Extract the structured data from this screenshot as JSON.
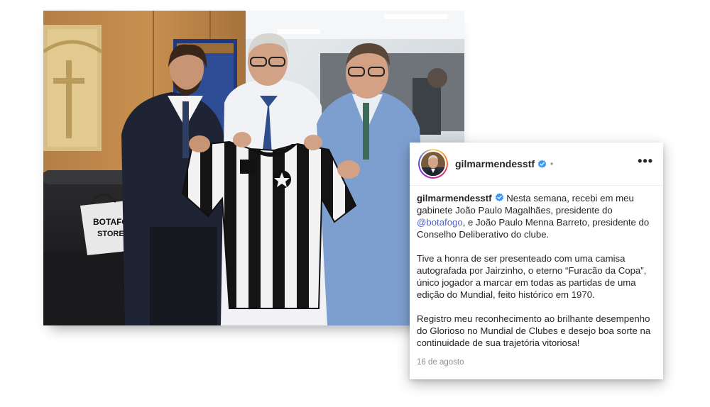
{
  "post": {
    "username": "gilmarmendesstf",
    "separator": "•",
    "more_label": "•••",
    "caption": {
      "username": "gilmarmendesstf",
      "p1_text_a": " Nesta semana, recebi em meu gabinete João Paulo Magalhães, presidente do ",
      "p1_mention": "@botafogo",
      "p1_text_b": ", e João Paulo Menna Barreto, presidente do Conselho Deliberativo do clube.",
      "p2": "Tive a honra de ser presenteado com uma camisa autografada por Jairzinho, o eterno “Furacão da Copa”, único jogador a marcar em todas as partidas de uma edição do Mundial, feito histórico em 1970.",
      "p3": "Registro meu reconhecimento ao brilhante desempenho do Glorioso no Mundial de Clubes e desejo boa sorte na continuidade de sua trajetória vitoriosa!"
    },
    "date": "16 de agosto",
    "icons": {
      "verified": "verified-badge-icon",
      "more": "more-options-icon"
    },
    "colors": {
      "verified": "#3897f0",
      "mention": "#4a5fd6",
      "date": "#8e8e8e"
    }
  },
  "photo": {
    "bag_text_line1": "BOTAFOGO",
    "bag_text_line2": "STORE"
  }
}
